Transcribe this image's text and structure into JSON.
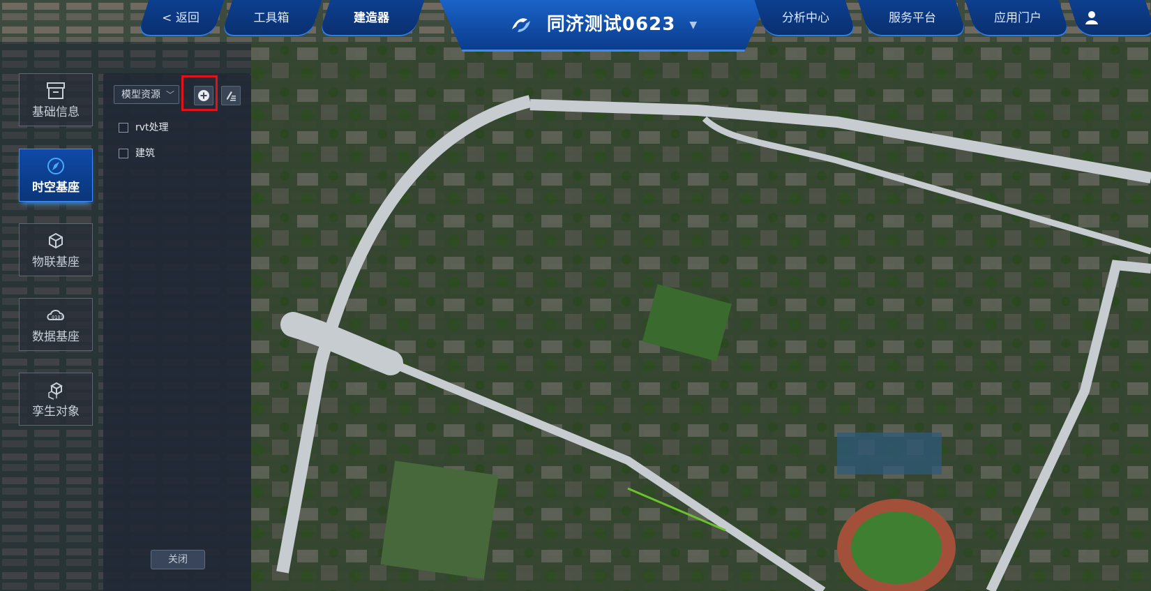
{
  "header": {
    "back_label": "< 返回",
    "tabs_left": [
      "工具箱",
      "建造器"
    ],
    "active_tab": "建造器",
    "project_title": "同济测试0623",
    "tabs_right": [
      "分析中心",
      "服务平台",
      "应用门户"
    ],
    "accent": "#0d3f8f"
  },
  "sidebar": {
    "items": [
      {
        "label": "基础信息",
        "icon": "archive-box-icon"
      },
      {
        "label": "时空基座",
        "icon": "compass-icon"
      },
      {
        "label": "物联基座",
        "icon": "network-cube-icon"
      },
      {
        "label": "数据基座",
        "icon": "cloud-data-icon"
      },
      {
        "label": "孪生对象",
        "icon": "cubes-icon"
      }
    ],
    "active_index": 1
  },
  "panel": {
    "select_value": "模型资源",
    "add_icon": "plus-circle-icon",
    "edit_icon": "edit-list-icon",
    "tree": [
      {
        "label": "rvt处理",
        "checked": false
      },
      {
        "label": "建筑",
        "checked": false
      }
    ],
    "close_label": "关闭"
  }
}
